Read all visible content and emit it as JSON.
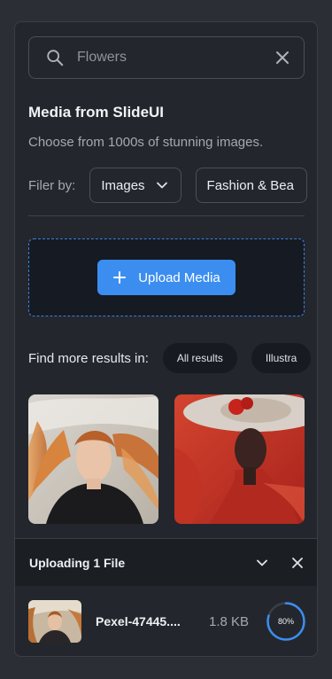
{
  "search": {
    "value": "Flowers",
    "placeholder": "Flowers"
  },
  "media": {
    "title": "Media from SlideUI",
    "subtitle": "Choose from 1000s of stunning images."
  },
  "filter": {
    "label": "Filer by:",
    "chips": [
      "Images",
      "Fashion & Bea"
    ]
  },
  "upload": {
    "button_label": "Upload Media"
  },
  "more_results": {
    "label": "Find more results in:",
    "pills": [
      "All results",
      "Illustra"
    ]
  },
  "tray": {
    "title": "Uploading 1 File",
    "file": {
      "name": "Pexel-47445....",
      "size": "1.8 KB",
      "progress_label": "80%",
      "progress": 0.8
    }
  },
  "colors": {
    "accent": "#3b8ef0",
    "panel": "#23272d",
    "dropzone_border": "#3f7fd6"
  },
  "icons": [
    "search-icon",
    "close-icon",
    "chevron-down-icon",
    "plus-icon"
  ]
}
